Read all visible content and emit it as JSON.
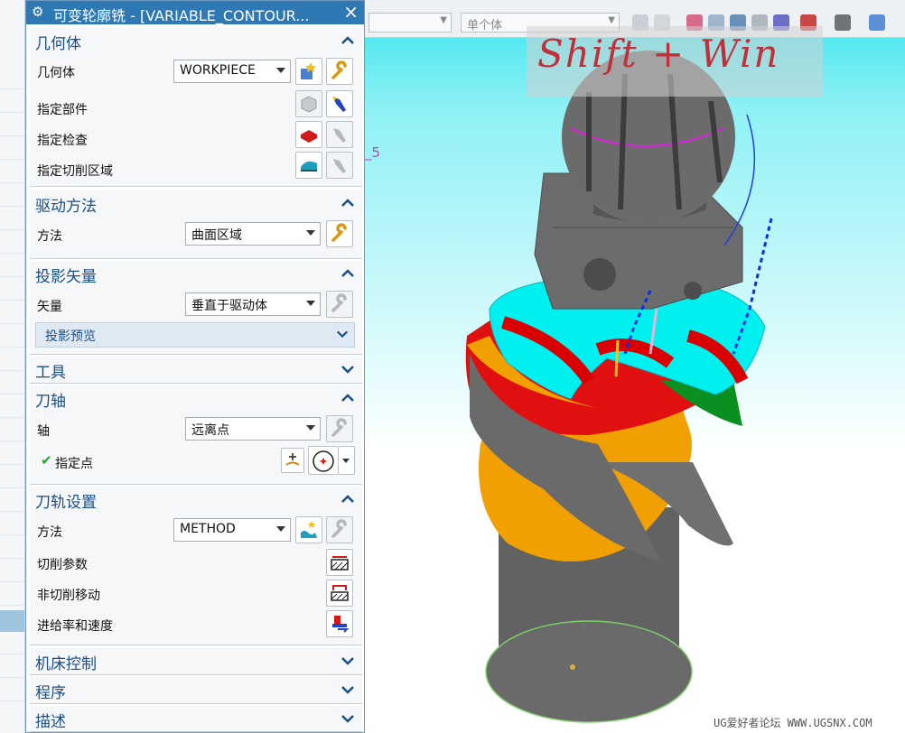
{
  "dialog": {
    "title": "可变轮廓铣 - [VARIABLE_CONTOUR...",
    "close_label": "×",
    "groups": {
      "geometry": {
        "title": "几何体",
        "geometry_label": "几何体",
        "geometry_value": "WORKPIECE",
        "part_label": "指定部件",
        "check_label": "指定检查",
        "cut_area_label": "指定切削区域"
      },
      "drive": {
        "title": "驱动方法",
        "method_label": "方法",
        "method_value": "曲面区域"
      },
      "projection": {
        "title": "投影矢量",
        "vector_label": "矢量",
        "vector_value": "垂直于驱动体",
        "preview_label": "投影预览"
      },
      "tool": {
        "title": "工具"
      },
      "axis": {
        "title": "刀轴",
        "axis_label": "轴",
        "axis_value": "远离点",
        "point_label": "指定点",
        "check_mark": "✔"
      },
      "path": {
        "title": "刀轨设置",
        "method_label": "方法",
        "method_value": "METHOD",
        "cut_params_label": "切削参数",
        "non_cut_label": "非切削移动",
        "feeds_label": "进给率和速度"
      },
      "machine": {
        "title": "机床控制"
      },
      "program": {
        "title": "程序"
      },
      "description": {
        "title": "描述"
      }
    }
  },
  "toolbar": {
    "selection_scope": "单个体"
  },
  "viewport": {
    "hint_overlay": "Shift + Win",
    "stray_label": "_5",
    "watermark": "UG爱好者论坛 WWW.UGSNX.COM"
  },
  "icons": {
    "settings": "gear-icon",
    "expand": "chevron-down-icon",
    "collapse": "chevron-up-icon",
    "edit": "wrench-icon",
    "new": "new-geometry-icon",
    "display": "flashlight-icon",
    "part": "part-cube-icon",
    "check": "check-geometry-icon",
    "cut_area": "cut-area-icon",
    "point": "point-dialog-icon",
    "inferred_point": "inferred-point-icon",
    "cut_params": "cut-params-icon",
    "non_cut": "non-cutting-moves-icon",
    "feeds": "feeds-speeds-icon",
    "method_new": "new-method-icon"
  },
  "colors": {
    "title_bar": "#2e79b3",
    "group_text": "#1a4f86",
    "viewport_top": "#55e8ef",
    "part_orange": "#f0a000",
    "part_red": "#e01010",
    "part_green": "#0a9020",
    "part_gray": "#707070",
    "part_cyan": "#00f0f0"
  }
}
